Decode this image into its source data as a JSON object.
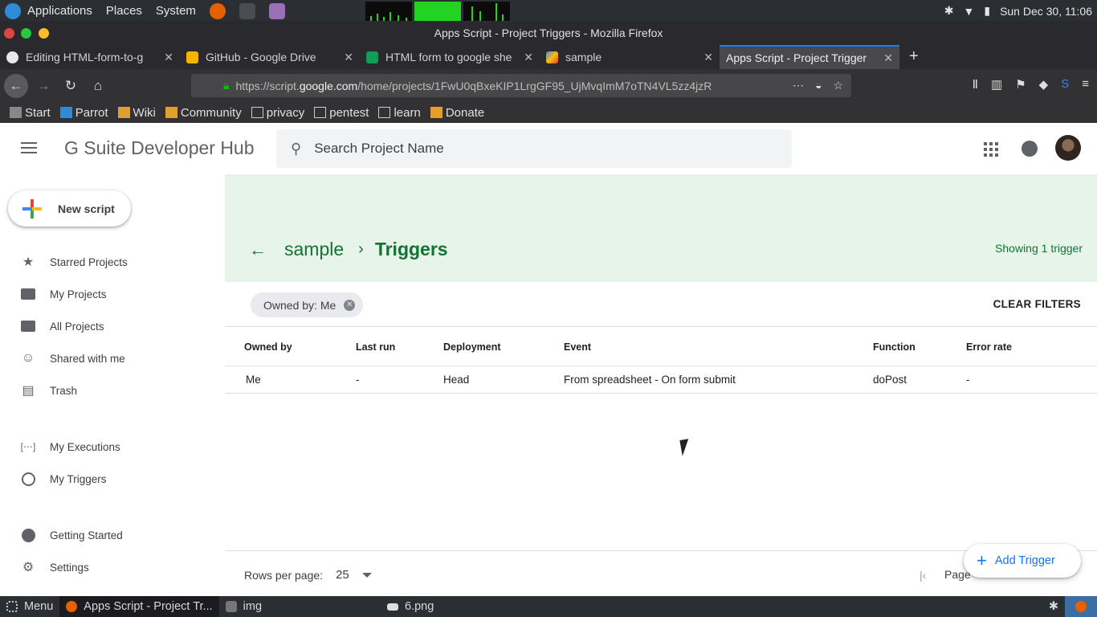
{
  "os": {
    "menus": [
      "Applications",
      "Places",
      "System"
    ],
    "clock": "Sun Dec 30, 11:06",
    "notification_badge": "0"
  },
  "window": {
    "title": "Apps Script - Project Triggers - Mozilla Firefox"
  },
  "tabs": [
    {
      "label": "Editing HTML-form-to-g",
      "icon": "github-icon",
      "color": "#e8e8e8"
    },
    {
      "label": "GitHub - Google Drive",
      "icon": "google-drive-icon",
      "color": "#f4b400"
    },
    {
      "label": "HTML form to google she",
      "icon": "google-sheets-icon",
      "color": "#0f9d58"
    },
    {
      "label": "sample",
      "icon": "apps-script-icon",
      "color": "#4285f4"
    },
    {
      "label": "Apps Script - Project Trigger",
      "icon": "apps-script-icon",
      "color": "#4285f4"
    }
  ],
  "url": {
    "prefix": "https://script.",
    "host": "google.com",
    "path": "/home/projects/1FwU0qBxeKIP1LrgGF95_UjMvqImM7oTN4VL5zz4jzR"
  },
  "bookmarks": [
    "Start",
    "Parrot",
    "Wiki",
    "Community",
    "privacy",
    "pentest",
    "learn",
    "Donate"
  ],
  "app": {
    "brand": "G Suite Developer Hub",
    "search_placeholder": "Search Project Name"
  },
  "sidebar": {
    "new_script": "New script",
    "items": [
      {
        "label": "Starred Projects",
        "icon": "star-icon"
      },
      {
        "label": "My Projects",
        "icon": "folder-icon"
      },
      {
        "label": "All Projects",
        "icon": "folder-icon"
      },
      {
        "label": "Shared with me",
        "icon": "people-icon"
      },
      {
        "label": "Trash",
        "icon": "trash-icon"
      },
      {
        "label": "My Executions",
        "icon": "executions-icon"
      },
      {
        "label": "My Triggers",
        "icon": "alarm-icon"
      },
      {
        "label": "Getting Started",
        "icon": "play-icon"
      },
      {
        "label": "Settings",
        "icon": "gear-icon"
      }
    ]
  },
  "breadcrumb": {
    "project": "sample",
    "current": "Triggers"
  },
  "showing": "Showing 1 trigger",
  "filter": {
    "chip": "Owned by: Me",
    "clear": "CLEAR FILTERS"
  },
  "table": {
    "headers": [
      "Owned by",
      "Last run",
      "Deployment",
      "Event",
      "Function",
      "Error rate"
    ],
    "rows": [
      [
        "Me",
        "-",
        "Head",
        "From spreadsheet - On form submit",
        "doPost",
        "-"
      ]
    ]
  },
  "footer": {
    "rows_per_page_label": "Rows per page:",
    "rows_per_page": "25",
    "page_label": "Page"
  },
  "add_trigger": "Add Trigger",
  "taskbar": {
    "menu": "Menu",
    "items": [
      "Apps Script - Project Tr...",
      "img",
      "6.png"
    ]
  }
}
